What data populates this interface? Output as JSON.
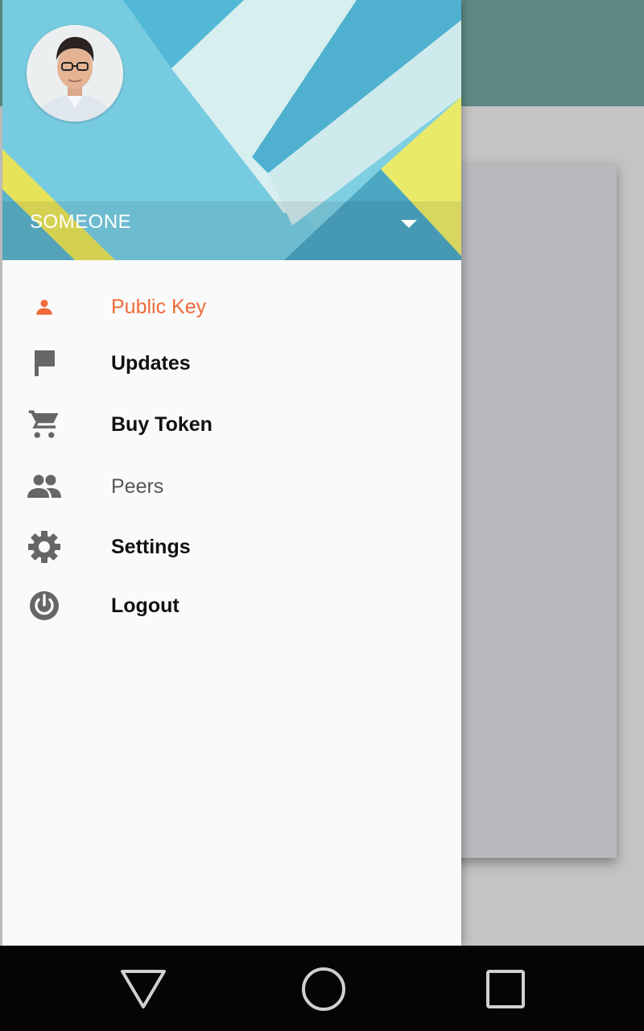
{
  "account": {
    "name": "SOMEONE",
    "avatar_icon": "profile-photo"
  },
  "menu": {
    "items": [
      {
        "label": "Public Key",
        "icon": "person-icon",
        "state": "active"
      },
      {
        "label": "Updates",
        "icon": "flag-icon",
        "state": "normal"
      },
      {
        "label": "Buy Token",
        "icon": "cart-icon",
        "state": "normal"
      },
      {
        "label": "Peers",
        "icon": "group-icon",
        "state": "muted"
      },
      {
        "label": "Settings",
        "icon": "gear-icon",
        "state": "normal"
      },
      {
        "label": "Logout",
        "icon": "power-icon",
        "state": "normal"
      }
    ]
  },
  "colors": {
    "accent": "#ef6b3a",
    "icon_gray": "#666666",
    "appbar_scrim": "#5f8a84",
    "drawer_bg": "#fafafa"
  },
  "navbar": {
    "buttons": [
      "back-icon",
      "home-icon",
      "recents-icon"
    ]
  }
}
